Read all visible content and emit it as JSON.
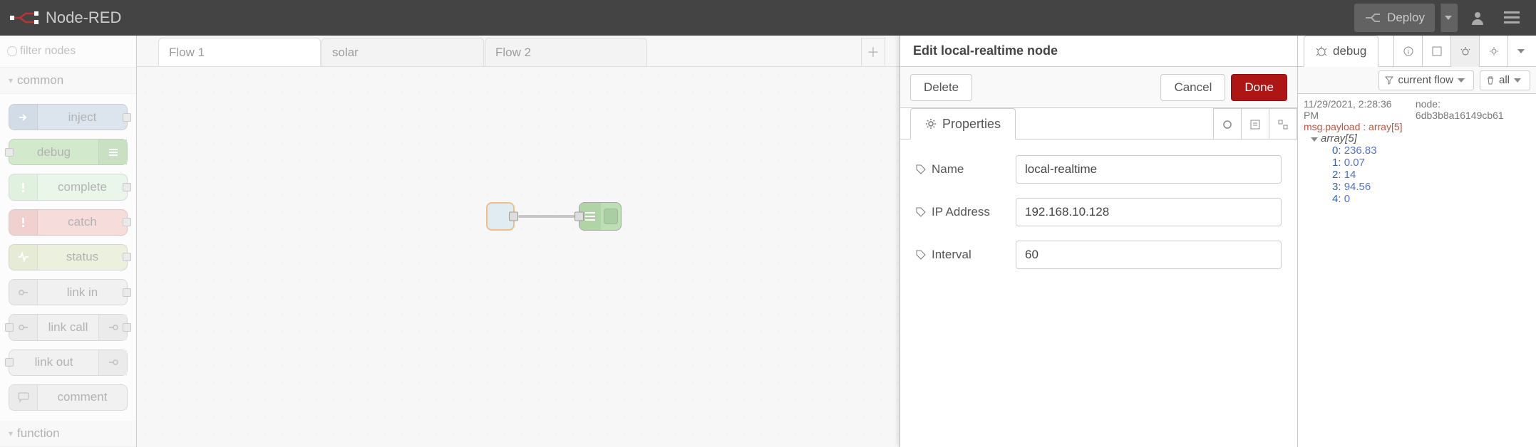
{
  "app_title": "Node-RED",
  "header": {
    "deploy_label": "Deploy"
  },
  "palette": {
    "filter_placeholder": "filter nodes",
    "categories": [
      {
        "name": "common",
        "expanded": true
      },
      {
        "name": "function",
        "expanded": true
      }
    ],
    "nodes": [
      {
        "label": "inject",
        "cls": "n-inject",
        "port": "right",
        "icon": "arrow-in"
      },
      {
        "label": "debug",
        "cls": "n-debug",
        "port": "left",
        "icon_r": "list"
      },
      {
        "label": "complete",
        "cls": "n-complete",
        "port": "right",
        "icon": "exclaim-g"
      },
      {
        "label": "catch",
        "cls": "n-catch",
        "port": "right",
        "icon": "exclaim-r"
      },
      {
        "label": "status",
        "cls": "n-status",
        "port": "right",
        "icon": "pulse"
      },
      {
        "label": "link in",
        "cls": "n-link",
        "port": "right",
        "icon": "link-in"
      },
      {
        "label": "link call",
        "cls": "n-link",
        "port": "both",
        "icon": "link-in",
        "icon_r": "link-out"
      },
      {
        "label": "link out",
        "cls": "n-link",
        "port": "left",
        "icon_r": "link-out"
      },
      {
        "label": "comment",
        "cls": "n-link",
        "port": "none",
        "icon": "comment"
      }
    ]
  },
  "workspace": {
    "tabs": [
      {
        "label": "Flow 1",
        "active": true
      },
      {
        "label": "solar",
        "active": false
      },
      {
        "label": "Flow 2",
        "active": false
      }
    ]
  },
  "editor": {
    "title": "Edit local-realtime node",
    "delete_label": "Delete",
    "cancel_label": "Cancel",
    "done_label": "Done",
    "properties_label": "Properties",
    "fields": {
      "name_label": "Name",
      "name_value": "local-realtime",
      "ip_label": "IP Address",
      "ip_value": "192.168.10.128",
      "interval_label": "Interval",
      "interval_value": "60"
    }
  },
  "sidebar": {
    "active_tab": "debug",
    "toolbar": {
      "filter_label": "current flow",
      "clear_label": "all"
    },
    "debug": {
      "timestamp": "11/29/2021, 2:28:36 PM",
      "node_label": "node: 6db3b8a16149cb61",
      "payload_label": "msg.payload : array[5]",
      "array_header": "array[5]",
      "items": [
        {
          "k": "0",
          "v": "236.83"
        },
        {
          "k": "1",
          "v": "0.07"
        },
        {
          "k": "2",
          "v": "14"
        },
        {
          "k": "3",
          "v": "94.56"
        },
        {
          "k": "4",
          "v": "0"
        }
      ]
    }
  }
}
